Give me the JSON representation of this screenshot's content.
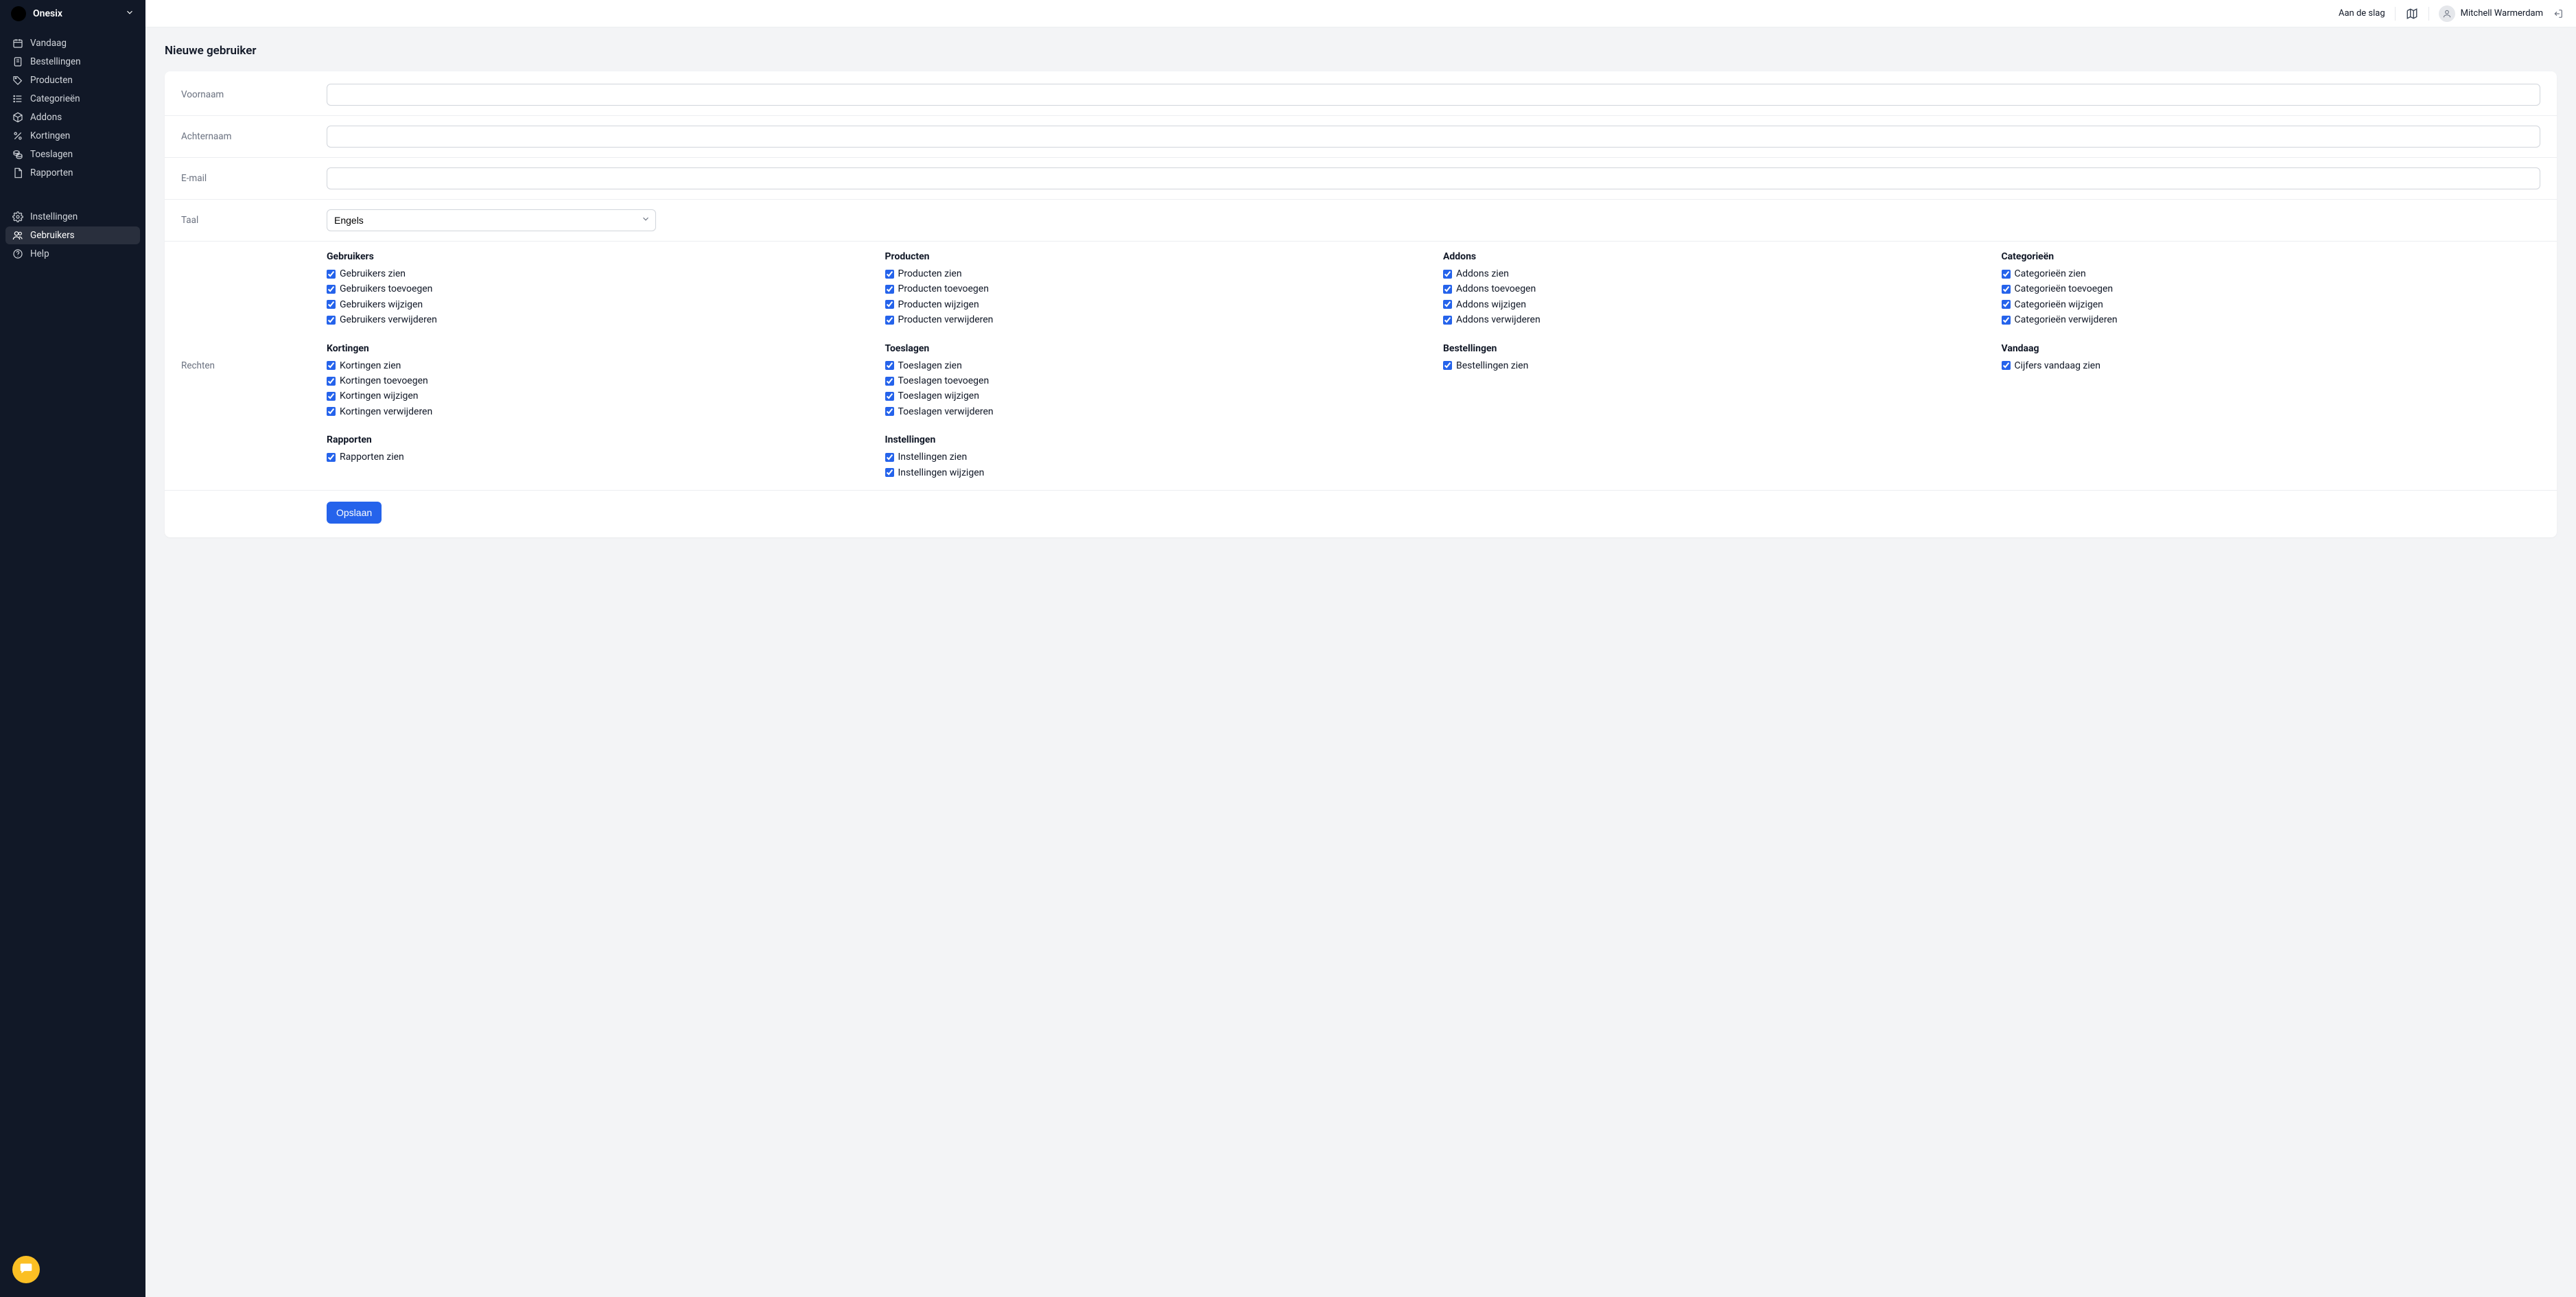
{
  "brand": {
    "name": "Onesix"
  },
  "sidebar": {
    "items": [
      {
        "id": "today",
        "label": "Vandaag",
        "icon": "calendar-icon"
      },
      {
        "id": "orders",
        "label": "Bestellingen",
        "icon": "receipt-icon"
      },
      {
        "id": "products",
        "label": "Producten",
        "icon": "tag-icon"
      },
      {
        "id": "categories",
        "label": "Categorieën",
        "icon": "list-icon"
      },
      {
        "id": "addons",
        "label": "Addons",
        "icon": "cube-icon"
      },
      {
        "id": "discounts",
        "label": "Kortingen",
        "icon": "percent-icon"
      },
      {
        "id": "surcharges",
        "label": "Toeslagen",
        "icon": "coins-icon"
      },
      {
        "id": "reports",
        "label": "Rapporten",
        "icon": "document-icon"
      }
    ],
    "secondary": [
      {
        "id": "settings",
        "label": "Instellingen",
        "icon": "gear-icon"
      },
      {
        "id": "users",
        "label": "Gebruikers",
        "icon": "users-icon",
        "active": true
      },
      {
        "id": "help",
        "label": "Help",
        "icon": "help-icon",
        "external": true
      }
    ]
  },
  "topbar": {
    "get_started": "Aan de slag",
    "user_name": "Mitchell Warmerdam"
  },
  "page": {
    "title": "Nieuwe gebruiker"
  },
  "form": {
    "labels": {
      "first_name": "Voornaam",
      "last_name": "Achternaam",
      "email": "E-mail",
      "language": "Taal",
      "permissions": "Rechten"
    },
    "values": {
      "first_name": "",
      "last_name": "",
      "email": "",
      "language_selected": "Engels"
    },
    "permission_groups": [
      {
        "title": "Gebruikers",
        "items": [
          "Gebruikers zien",
          "Gebruikers toevoegen",
          "Gebruikers wijzigen",
          "Gebruikers verwijderen"
        ]
      },
      {
        "title": "Producten",
        "items": [
          "Producten zien",
          "Producten toevoegen",
          "Producten wijzigen",
          "Producten verwijderen"
        ]
      },
      {
        "title": "Addons",
        "items": [
          "Addons zien",
          "Addons toevoegen",
          "Addons wijzigen",
          "Addons verwijderen"
        ]
      },
      {
        "title": "Categorieën",
        "items": [
          "Categorieën zien",
          "Categorieën toevoegen",
          "Categorieën wijzigen",
          "Categorieën verwijderen"
        ]
      },
      {
        "title": "Kortingen",
        "items": [
          "Kortingen zien",
          "Kortingen toevoegen",
          "Kortingen wijzigen",
          "Kortingen verwijderen"
        ]
      },
      {
        "title": "Toeslagen",
        "items": [
          "Toeslagen zien",
          "Toeslagen toevoegen",
          "Toeslagen wijzigen",
          "Toeslagen verwijderen"
        ]
      },
      {
        "title": "Bestellingen",
        "items": [
          "Bestellingen zien"
        ]
      },
      {
        "title": "Vandaag",
        "items": [
          "Cijfers vandaag zien"
        ]
      },
      {
        "title": "Rapporten",
        "items": [
          "Rapporten zien"
        ]
      },
      {
        "title": "Instellingen",
        "items": [
          "Instellingen zien",
          "Instellingen wijzigen"
        ]
      }
    ],
    "save_label": "Opslaan"
  }
}
